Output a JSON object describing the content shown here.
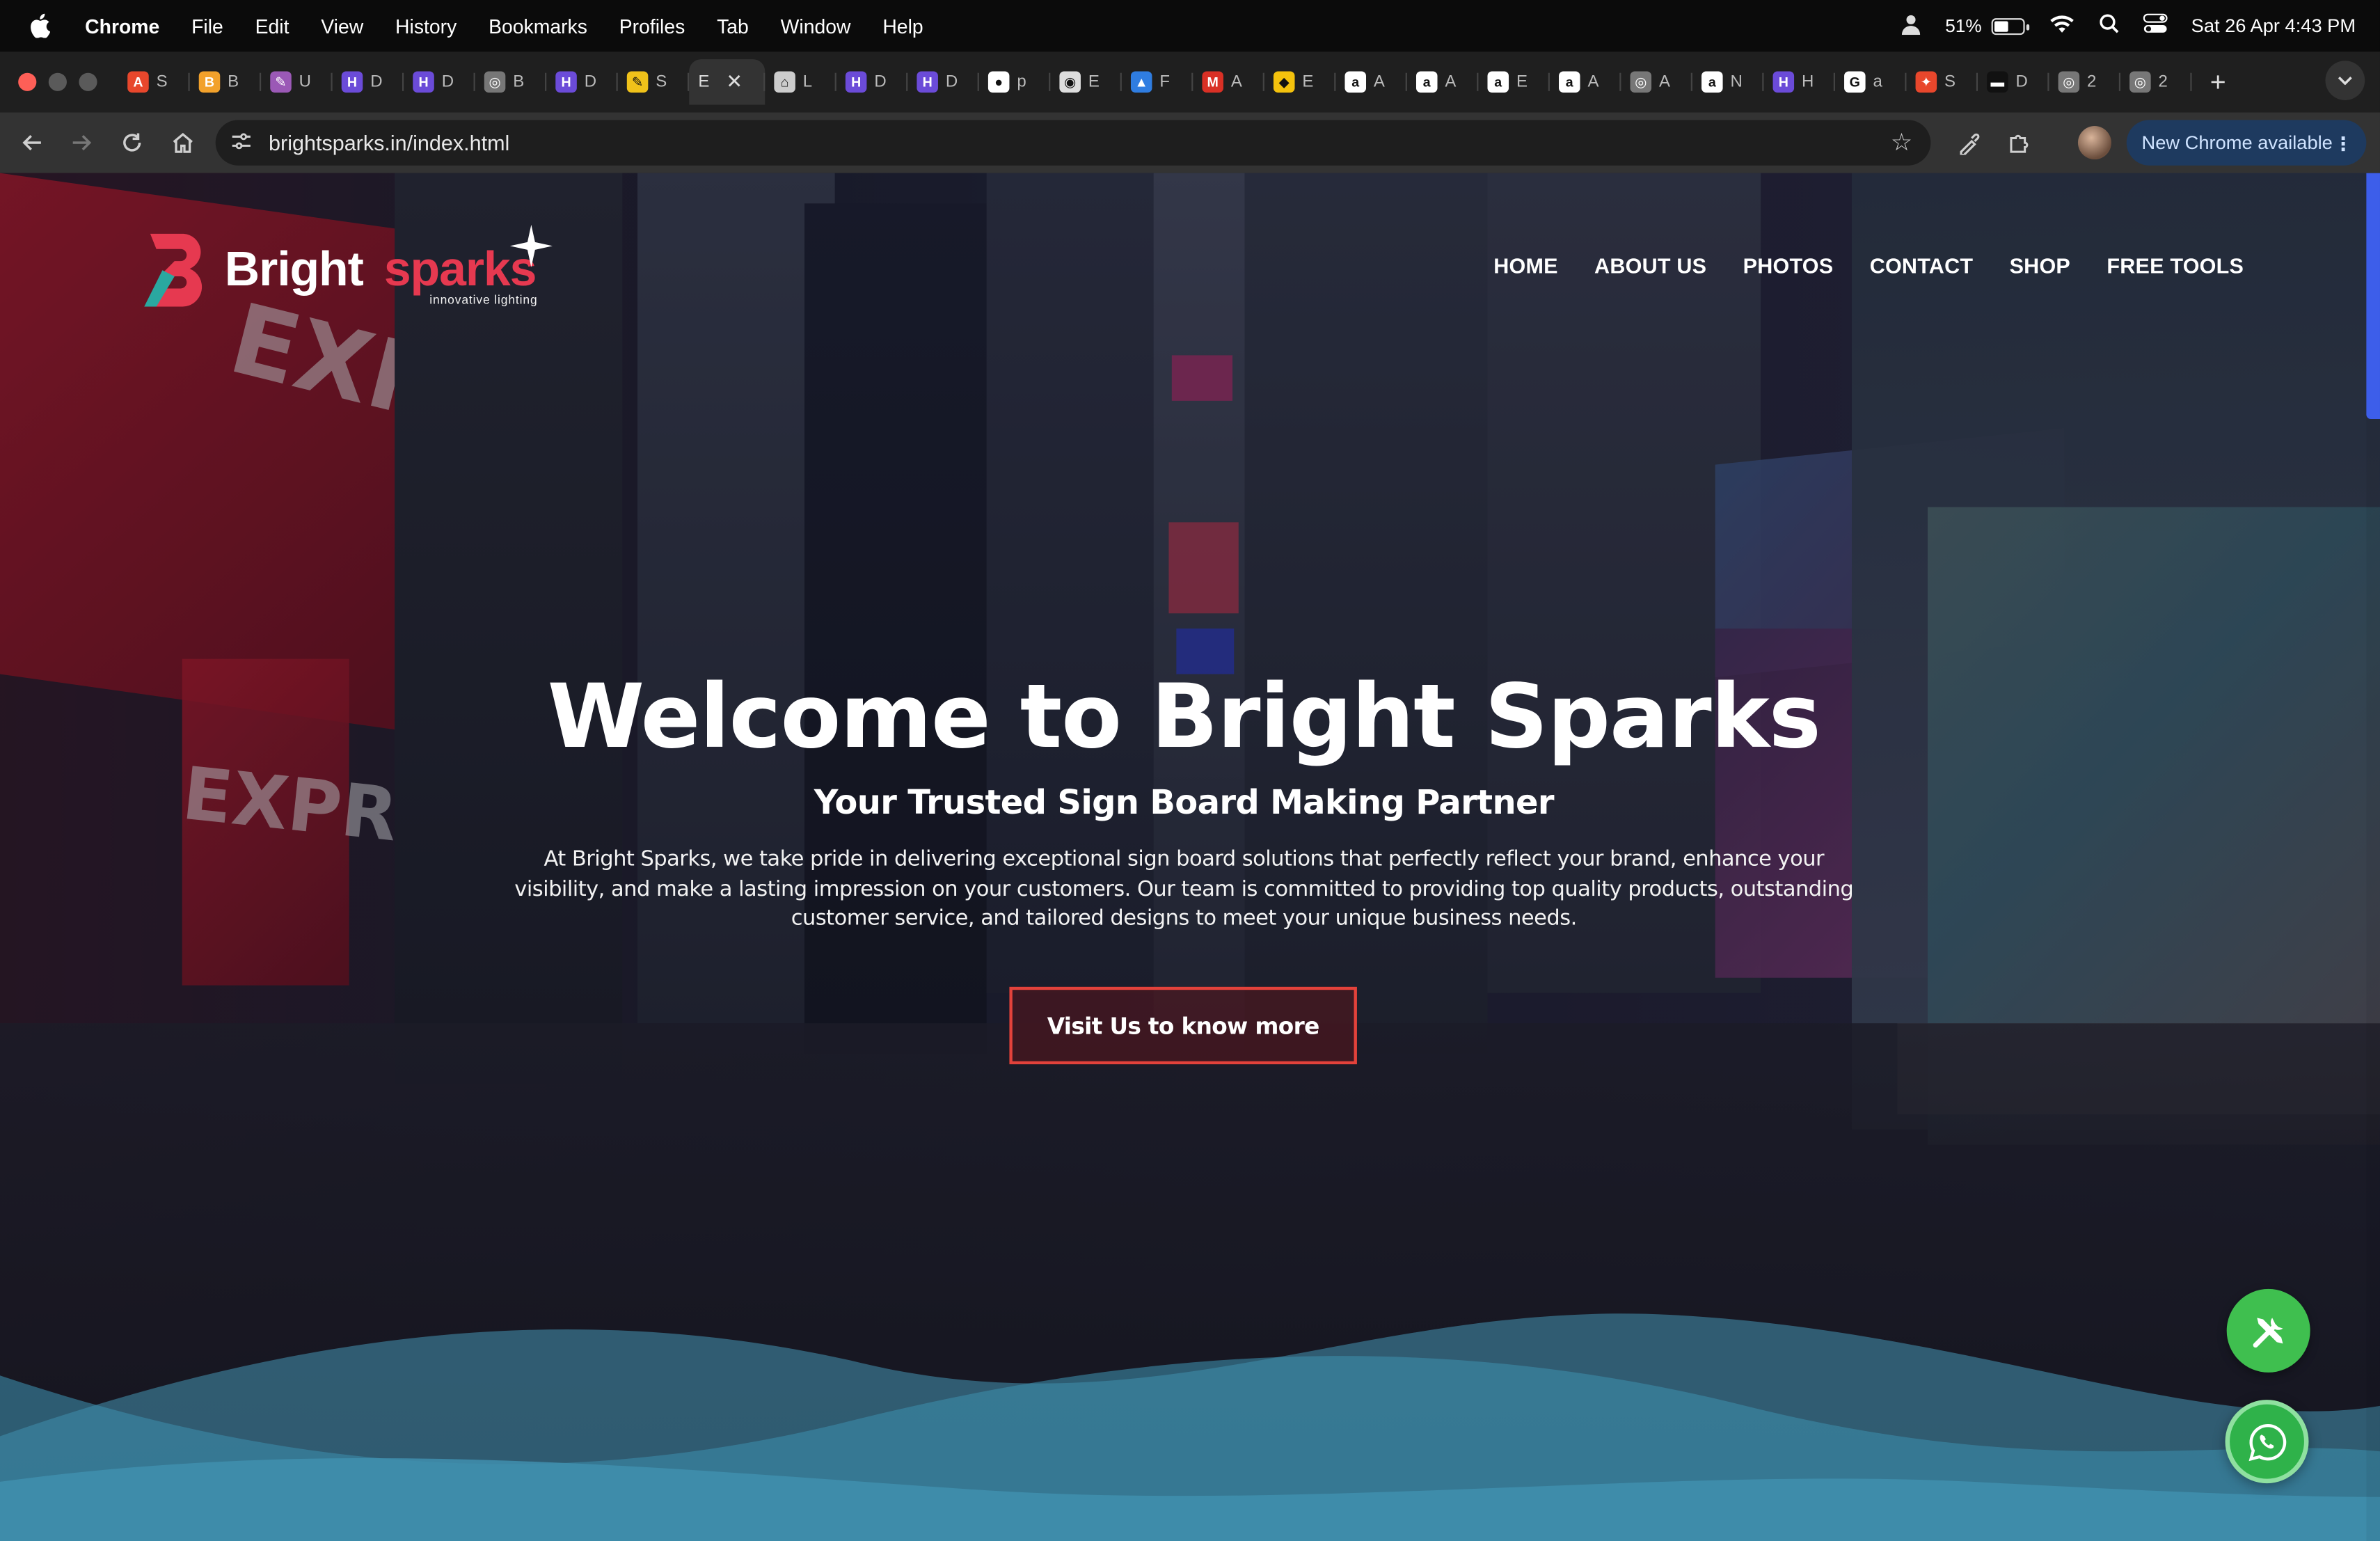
{
  "menubar": {
    "app": "Chrome",
    "items": [
      "File",
      "Edit",
      "View",
      "History",
      "Bookmarks",
      "Profiles",
      "Tab",
      "Window",
      "Help"
    ],
    "battery": "51%",
    "battery_level": 0.51,
    "datetime": "Sat 26 Apr  4:43 PM"
  },
  "tabs": [
    {
      "letter": "S",
      "color": "#e8472c",
      "glyph": "A"
    },
    {
      "letter": "B",
      "color": "#f2a12b",
      "glyph": "B"
    },
    {
      "letter": "U",
      "color": "#9b59b6",
      "glyph": "✎"
    },
    {
      "letter": "D",
      "color": "#6b4bd8",
      "glyph": "H"
    },
    {
      "letter": "D",
      "color": "#6b4bd8",
      "glyph": "H"
    },
    {
      "letter": "B",
      "color": "#777777",
      "glyph": "◎"
    },
    {
      "letter": "D",
      "color": "#6b4bd8",
      "glyph": "H"
    },
    {
      "letter": "S",
      "color": "#f0c21a",
      "glyph": "✎"
    },
    {
      "letter": "E",
      "color": "#333333",
      "glyph": "",
      "active": true
    },
    {
      "letter": "L",
      "color": "#cccccc",
      "glyph": "⌂"
    },
    {
      "letter": "D",
      "color": "#6b4bd8",
      "glyph": "H"
    },
    {
      "letter": "D",
      "color": "#6b4bd8",
      "glyph": "H"
    },
    {
      "letter": "p",
      "color": "#ffffff",
      "glyph": "●"
    },
    {
      "letter": "E",
      "color": "#dddddd",
      "glyph": "◉"
    },
    {
      "letter": "F",
      "color": "#2f7de1",
      "glyph": "▲"
    },
    {
      "letter": "A",
      "color": "#d93025",
      "glyph": "M"
    },
    {
      "letter": "E",
      "color": "#f4c20d",
      "glyph": "◆"
    },
    {
      "letter": "A",
      "color": "#ffffff",
      "glyph": "a"
    },
    {
      "letter": "A",
      "color": "#ffffff",
      "glyph": "a"
    },
    {
      "letter": "E",
      "color": "#ffffff",
      "glyph": "a"
    },
    {
      "letter": "A",
      "color": "#ffffff",
      "glyph": "a"
    },
    {
      "letter": "A",
      "color": "#777777",
      "glyph": "◎"
    },
    {
      "letter": "N",
      "color": "#ffffff",
      "glyph": "a"
    },
    {
      "letter": "H",
      "color": "#6b4bd8",
      "glyph": "H"
    },
    {
      "letter": "a",
      "color": "#ffffff",
      "glyph": "G"
    },
    {
      "letter": "S",
      "color": "#e8472c",
      "glyph": "✦"
    },
    {
      "letter": "D",
      "color": "#111111",
      "glyph": "▬"
    },
    {
      "letter": "2",
      "color": "#777777",
      "glyph": "◎"
    },
    {
      "letter": "2",
      "color": "#777777",
      "glyph": "◎"
    }
  ],
  "toolbar": {
    "url": "brightsparks.in/index.html",
    "update_label": "New Chrome available"
  },
  "site": {
    "brand_primary": "Bright",
    "brand_secondary": "sparks",
    "tagline": "innovative lighting",
    "nav": [
      "HOME",
      "ABOUT US",
      "PHOTOS",
      "CONTACT",
      "SHOP",
      "FREE TOOLS"
    ],
    "hero_title": "Welcome to Bright Sparks",
    "hero_subtitle": "Your Trusted Sign Board Making Partner",
    "hero_text": "At Bright Sparks, we take pride in delivering exceptional sign board solutions that perfectly reflect your brand, enhance your visibility, and make a lasting impression on your customers. Our team is committed to providing top quality products, outstanding customer service, and tailored designs to meet your unique business needs.",
    "cta_label": "Visit Us to know more"
  },
  "colors": {
    "brand_red": "#e63950",
    "brand_teal": "#2aa8a0",
    "cta_border": "#e3423b",
    "fab_green": "#3fbf4f",
    "wave": "#3f8fae",
    "scroll_thumb": "#3d5eea"
  },
  "icons": {
    "fab_tools": "tools-icon",
    "fab_chat": "whatsapp-icon"
  }
}
